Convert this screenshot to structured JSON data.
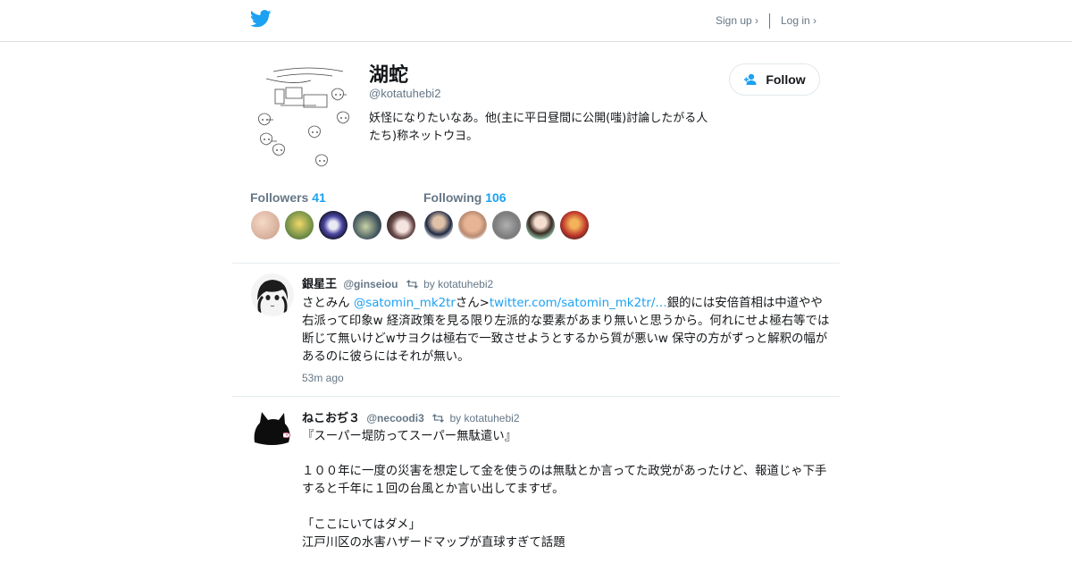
{
  "header": {
    "logo_icon": "twitter-bird-icon",
    "signup_label": "Sign up ›",
    "login_label": "Log in ›",
    "accent_color": "#1da1f2"
  },
  "profile": {
    "name": "湖蛇",
    "handle": "@kotatuhebi2",
    "bio": "妖怪になりたいなあ。他(主に平日昼間に公開(嗤)討論したがる人たち)称ネットウヨ。",
    "follow_label": "Follow",
    "followers_label": "Followers",
    "followers_count": "41",
    "following_label": "Following",
    "following_count": "106"
  },
  "tweets": [
    {
      "name": "銀星王",
      "handle": "@ginseiou",
      "retweeted_by": "by kotatuhebi2",
      "text_pre": "さとみん ",
      "mention": "@satomin_mk2tr",
      "text_mid": "さん>",
      "link": "twitter.com/satomin_mk2tr/…",
      "text_post": "銀的には安倍首相は中道やや右派って印象w 経済政策を見る限り左派的な要素があまり無いと思うから。何れにせよ極右等では断じて無いけどwサヨクは極右で一致させようとするから質が悪いw 保守の方がずっと解釈の幅があるのに彼らにはそれが無い。",
      "time": "53m ago"
    },
    {
      "name": "ねこおぢ３",
      "handle": "@necoodi3",
      "retweeted_by": "by kotatuhebi2",
      "line1": "『スーパー堤防ってスーパー無駄遣い』",
      "line2": "１００年に一度の災害を想定して金を使うのは無駄とか言ってた政党があったけど、報道じゃ下手すると千年に１回の台風とか言い出してますぜ。",
      "line3": "「ここにいてはダメ」",
      "line4": "江戸川区の水害ハザードマップが直球すぎて話題"
    }
  ]
}
